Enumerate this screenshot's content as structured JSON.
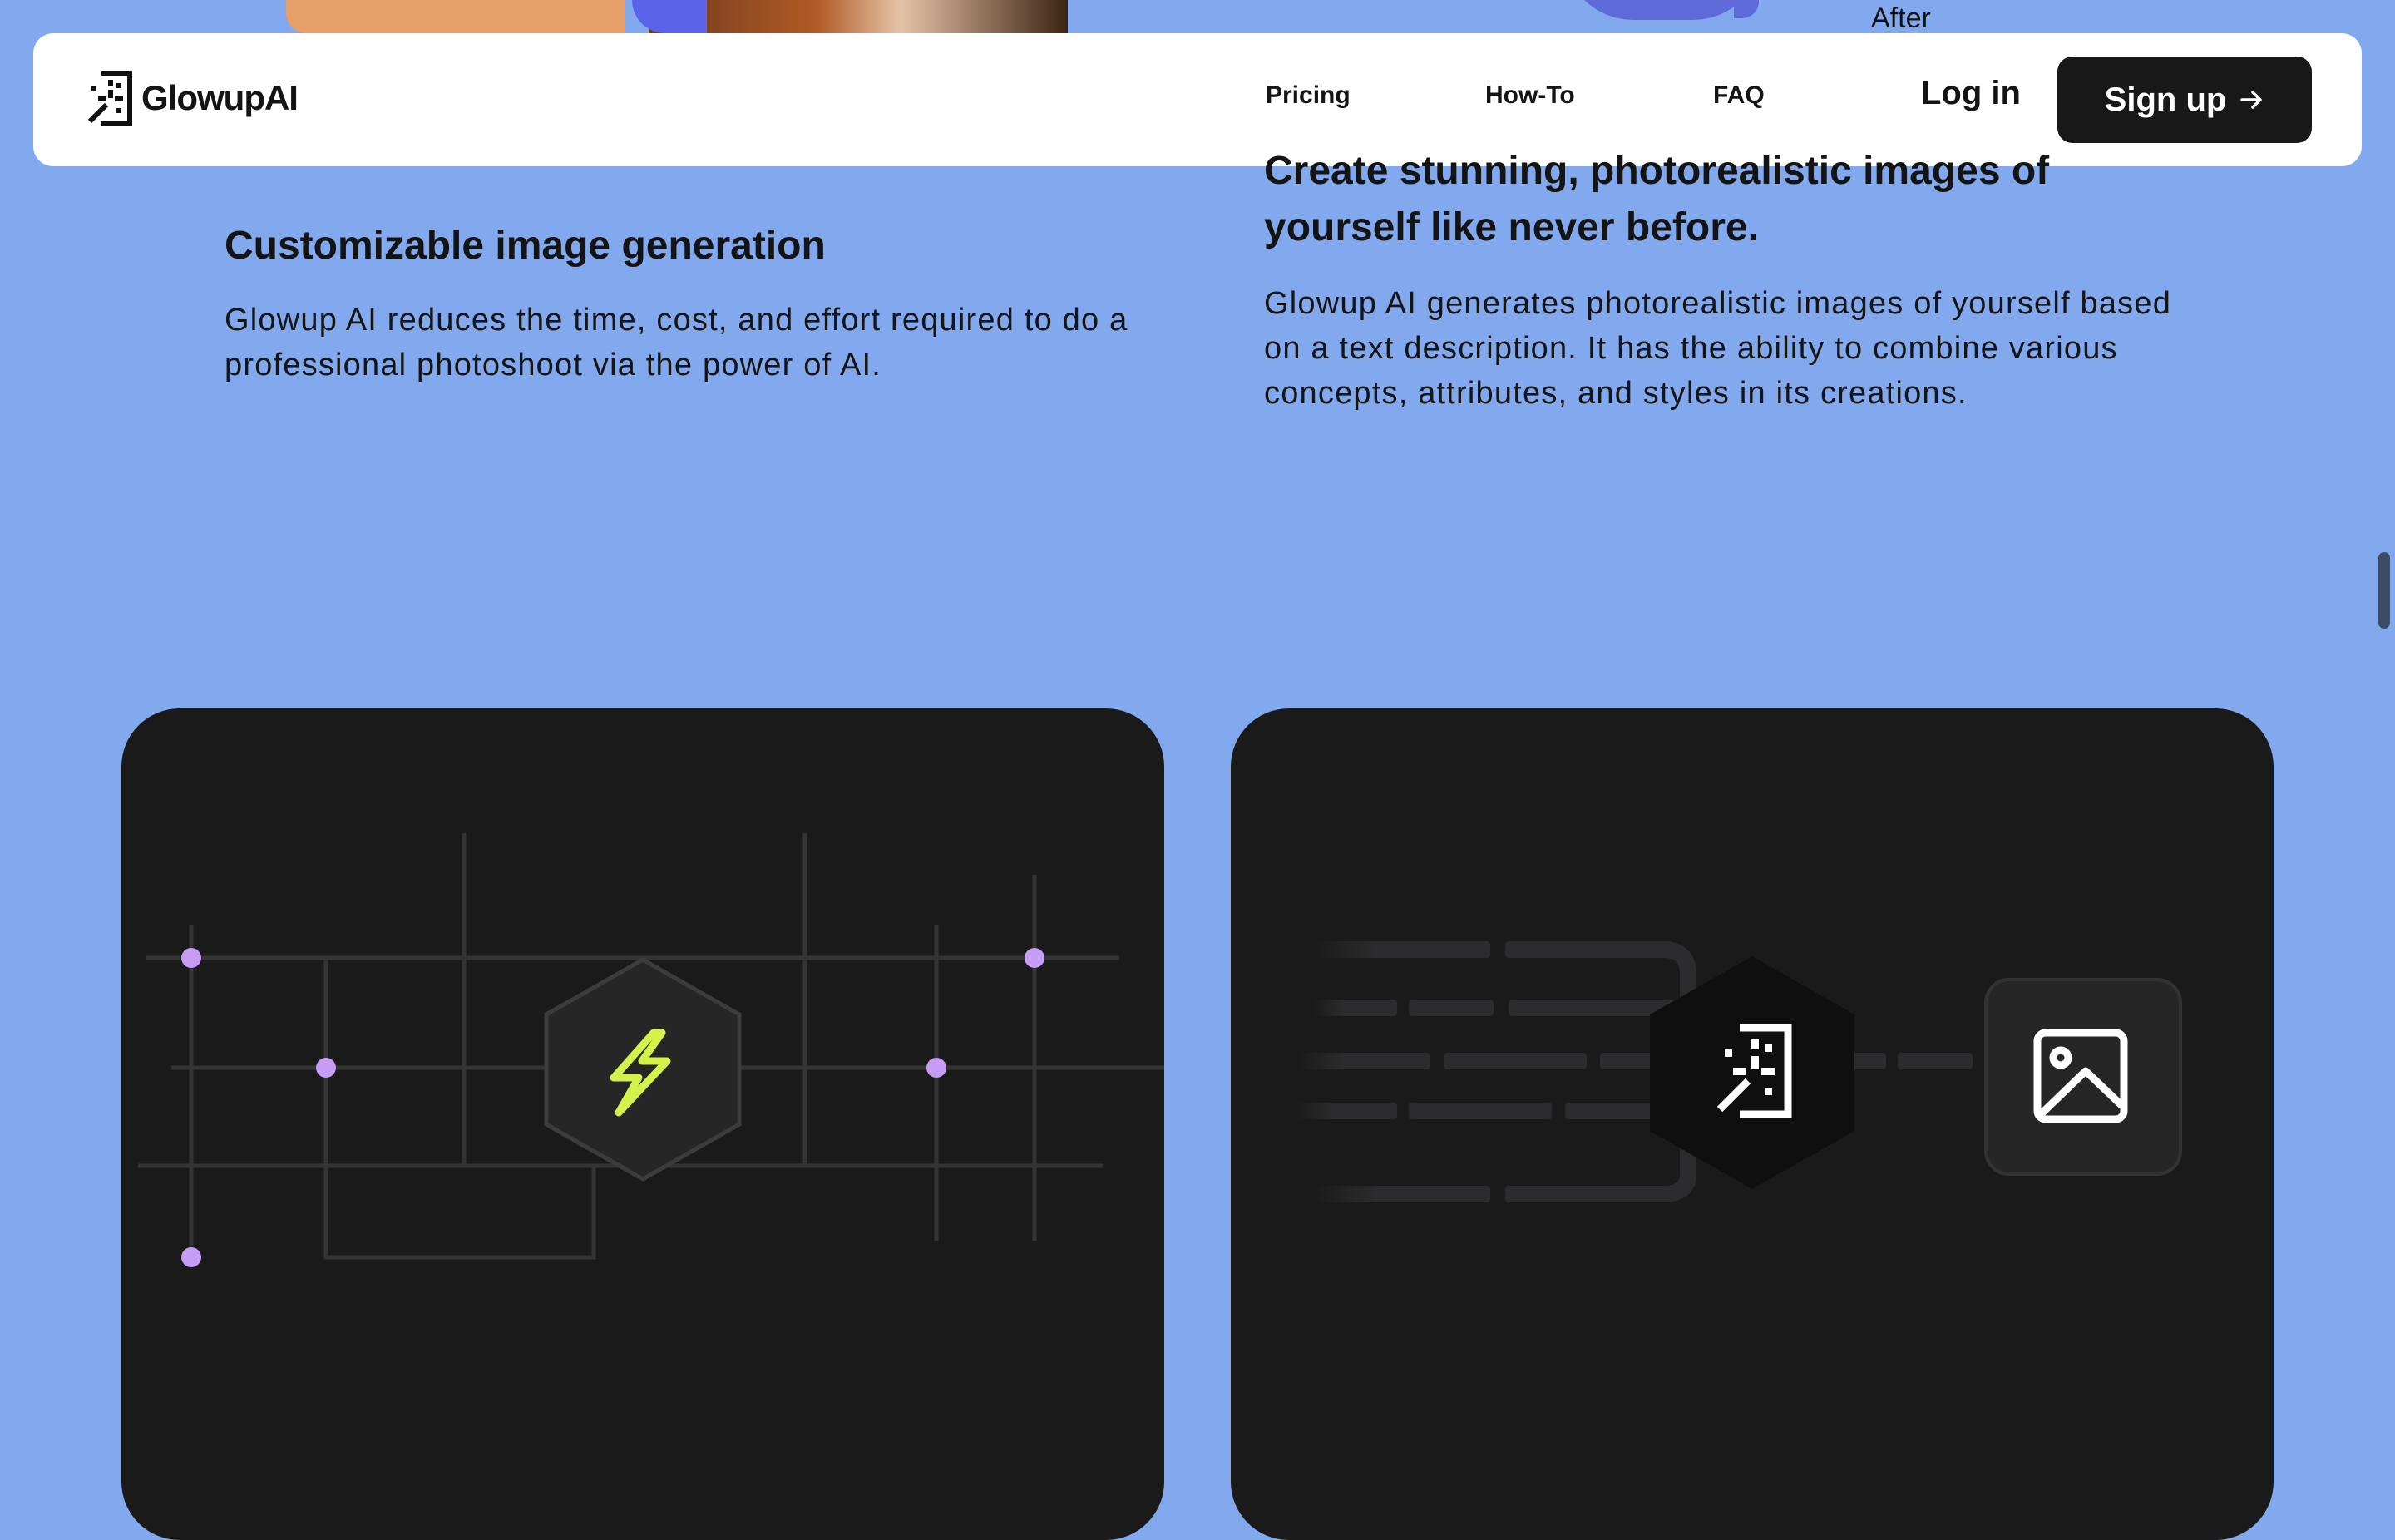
{
  "top_strip": {
    "after_label": "After"
  },
  "header": {
    "logo_text": "GlowupAI",
    "nav": [
      {
        "label": "Pricing"
      },
      {
        "label": "How-To"
      },
      {
        "label": "FAQ"
      }
    ],
    "login_label": "Log in",
    "signup_label": "Sign up"
  },
  "features": [
    {
      "title": "Customizable image generation",
      "description": "Glowup AI reduces the time, cost, and effort required to do a professional photoshoot via the power of AI."
    },
    {
      "title": "Create stunning, photorealistic images of yourself like never before.",
      "description": "Glowup AI generates photorealistic images of yourself based on a text description.  It has the ability to combine various concepts, attributes, and styles in its creations."
    }
  ],
  "icons": {
    "card_left": "lightning-icon",
    "card_right_center": "magic-wand-icon",
    "card_right_end": "image-icon"
  },
  "colors": {
    "background": "#82a9ee",
    "card": "#1a1a1a",
    "accent_lightning": "#d4f24a",
    "node_dot": "#c79cf5"
  }
}
